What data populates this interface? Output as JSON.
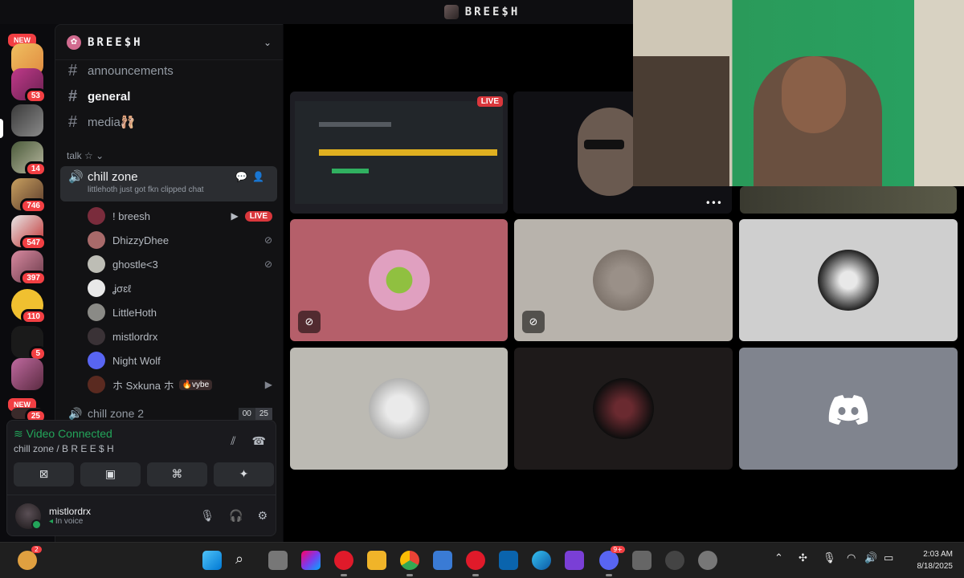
{
  "window": {
    "title": "BREE$H"
  },
  "rail": {
    "new_label": "NEW",
    "badges": [
      "53",
      "14",
      "746",
      "547",
      "397",
      "110",
      "5",
      "25"
    ]
  },
  "guild": {
    "name": "BREE$H"
  },
  "channels": {
    "text": [
      {
        "name": "announcements"
      },
      {
        "name": "general"
      },
      {
        "name": "media🩰"
      }
    ],
    "category": "talk ☆",
    "voice": {
      "name": "chill zone",
      "status": "littlehoth just got fkn clipped chat"
    },
    "users": [
      {
        "name": "! breesh",
        "live": "LIVE",
        "color": "#7a2c3c"
      },
      {
        "name": "DhizzyDhee",
        "color": "#a86a6a"
      },
      {
        "name": "ghostle<3",
        "color": "#bdbdb5"
      },
      {
        "name": "ʝσɛℓ",
        "color": "#e8e8e8"
      },
      {
        "name": "LittleHoth",
        "color": "#8a8a86"
      },
      {
        "name": "mistlordrx",
        "color": "#3a3236"
      },
      {
        "name": "Night Wolf",
        "color": "#5865f2"
      },
      {
        "name": "ホ Sxkuna ホ",
        "tag": "🔥vybe",
        "color": "#5a2a20"
      }
    ],
    "voice2": {
      "name": "chill zone 2",
      "count_a": "00",
      "count_b": "25"
    }
  },
  "voice_panel": {
    "status": "Video Connected",
    "location": "chill zone / B R E E $ H",
    "user": {
      "name": "mistlordrx",
      "status": "In voice"
    }
  },
  "stage": {
    "live_label": "LIVE",
    "more_label": "•••"
  },
  "taskbar": {
    "time": "2:03 AM",
    "date": "8/18/2025",
    "notif_count": "2",
    "discord_badge": "9+"
  },
  "colors": {
    "accent_green": "#23a55a",
    "danger_red": "#da373c",
    "blurple": "#5865f2"
  }
}
